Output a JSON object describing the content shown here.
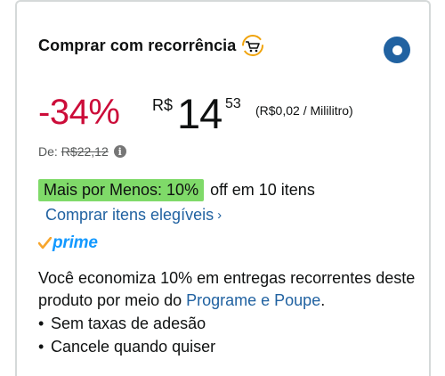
{
  "title": "Comprar com recorrência",
  "icons": {
    "subscribe": "cart-refresh-icon",
    "radio": "radio-selected-icon",
    "info": "info-icon",
    "chevron": "chevron-right-icon",
    "prime_check": "prime-check-icon"
  },
  "price": {
    "discount": "-34%",
    "currency": "R$",
    "whole": "14",
    "fraction": "53",
    "unit_price": "(R$0,02 / Mililitro)"
  },
  "list_price": {
    "label": "De:",
    "value": "R$22,12",
    "info_glyph": "i"
  },
  "promo": {
    "badge": "Mais por Menos: 10%",
    "rest": "off em 10 itens",
    "link": "Comprar itens elegíveis",
    "chevron": "›"
  },
  "prime": {
    "label": "prime"
  },
  "description": {
    "text": "Você economiza 10% em entregas recorrentes deste produto por meio do ",
    "link": "Programe e Poupe",
    "end": "."
  },
  "bullets": [
    "Sem taxas de adesão",
    "Cancele quando quiser"
  ],
  "colors": {
    "discount": "#cc0c39",
    "link": "#2162a1",
    "promo_badge": "#7fda69",
    "prime": "#1399ff",
    "prime_check": "#f7a62d",
    "radio": "#2162a1"
  }
}
